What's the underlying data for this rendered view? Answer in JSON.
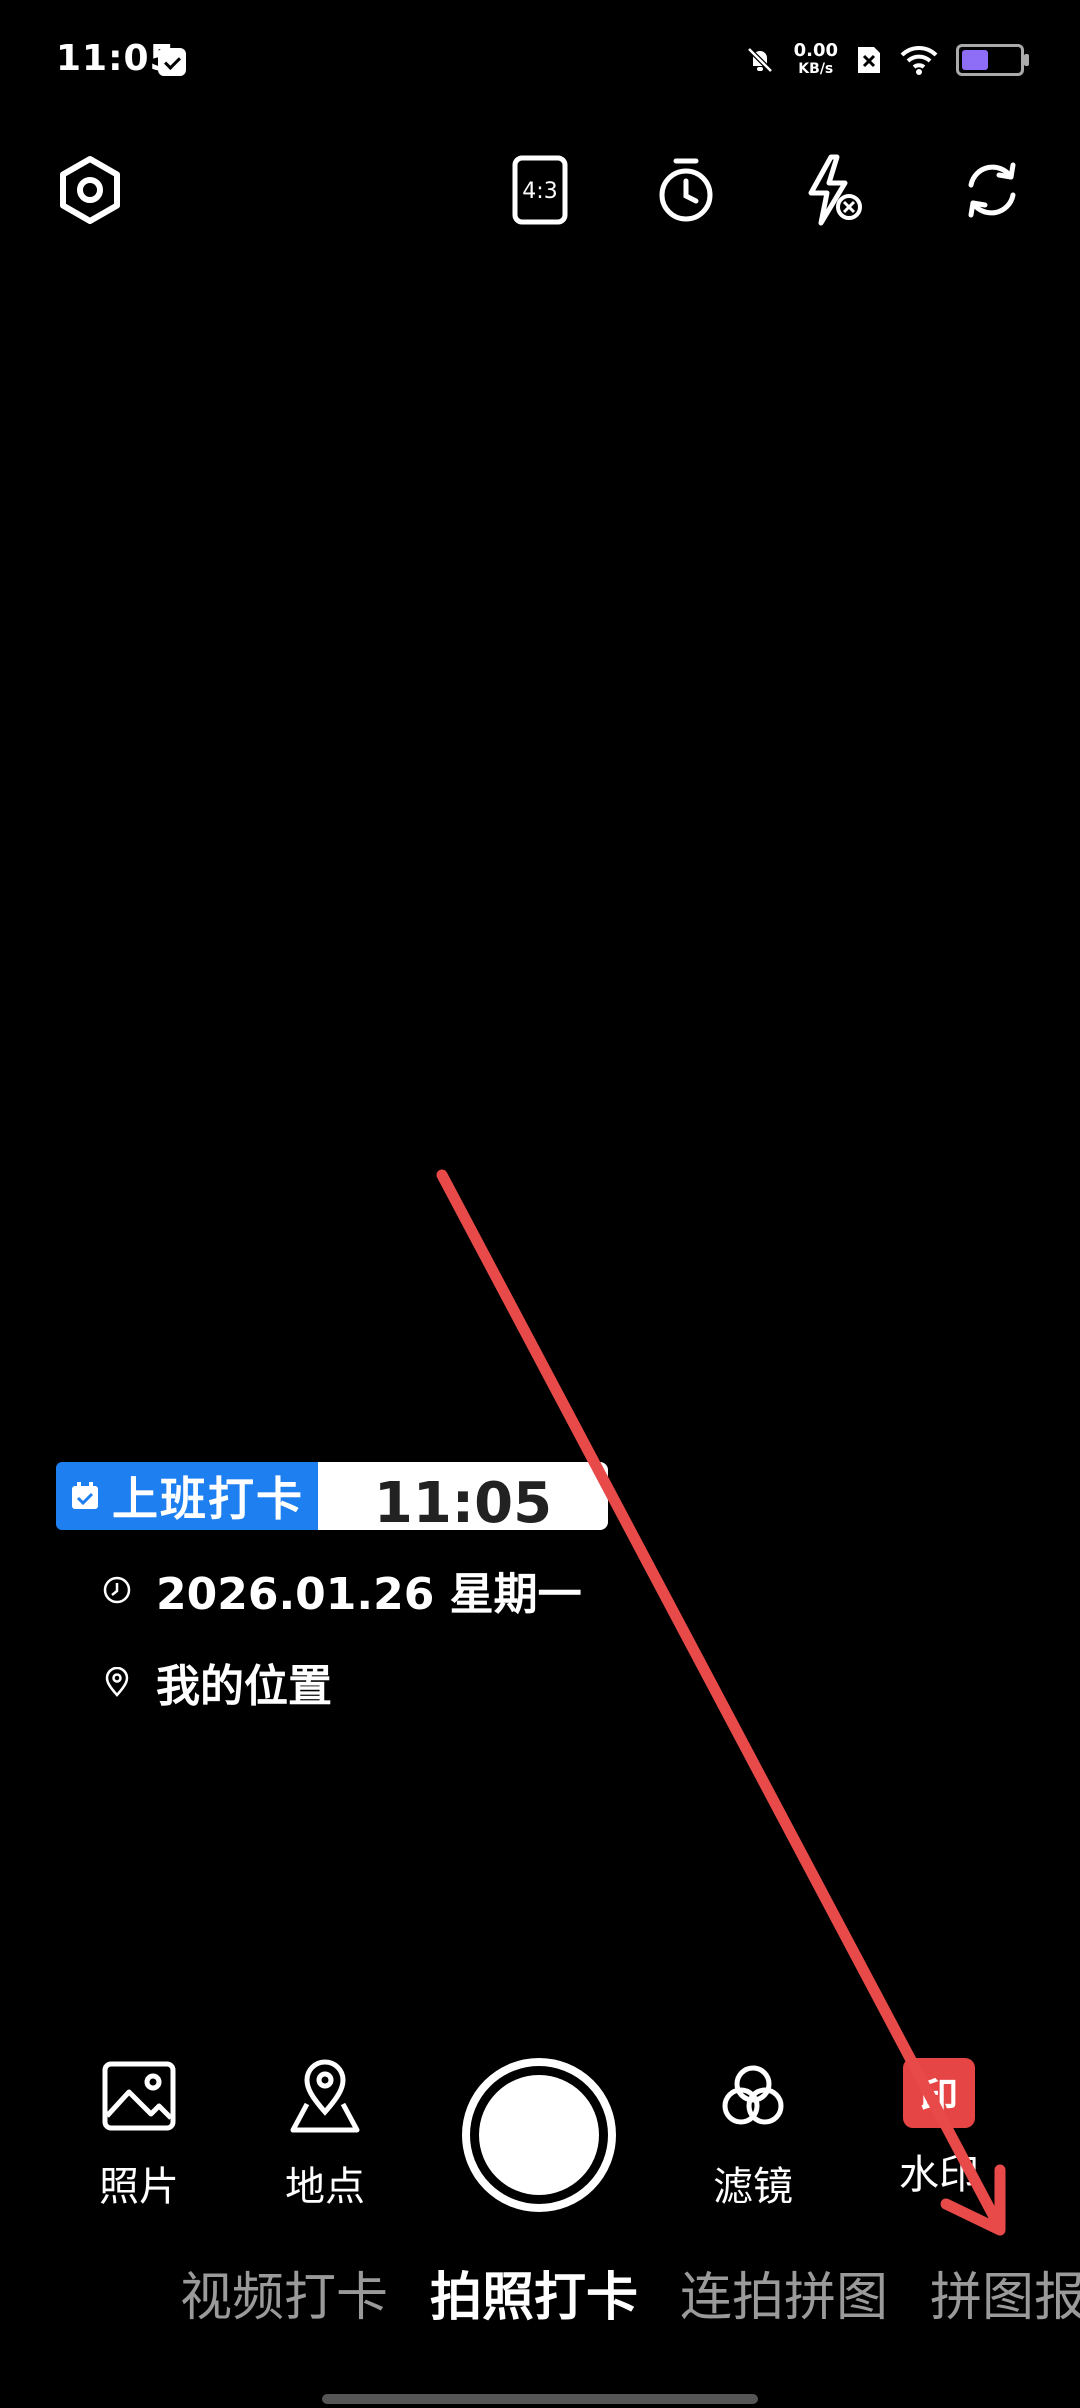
{
  "status_bar": {
    "time": "11:05",
    "net_speed_value": "0.00",
    "net_speed_unit": "KB/s"
  },
  "top_toolbar": {
    "aspect_ratio": "4:3"
  },
  "watermark": {
    "tag_label": "上班打卡",
    "time": "11:05",
    "date": "2026.01.26 星期一",
    "location": "我的位置"
  },
  "bottom_controls": {
    "photo_label": "照片",
    "location_label": "地点",
    "filter_label": "滤镜",
    "watermark_label": "水印",
    "watermark_badge": "印"
  },
  "modes": [
    {
      "label": "视频打卡",
      "active": false
    },
    {
      "label": "拍照打卡",
      "active": true
    },
    {
      "label": "连拍拼图",
      "active": false
    },
    {
      "label": "拼图报",
      "active": false
    }
  ],
  "colors": {
    "watermark_tag": "#1e7ff0",
    "watermark_badge": "#e64545",
    "annotation_arrow": "#e84a4a"
  },
  "icons": {
    "settings": "hexagon-settings-icon",
    "aspect": "aspect-ratio-icon",
    "timer": "timer-icon",
    "flash": "flash-off-icon",
    "switch": "switch-camera-icon"
  }
}
